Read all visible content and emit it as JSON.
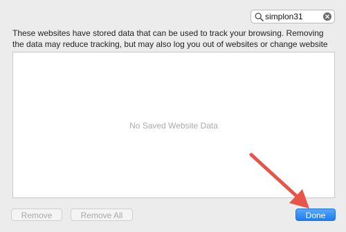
{
  "search": {
    "value": "simplon31"
  },
  "description": "These websites have stored data that can be used to track your browsing. Removing the data may reduce tracking, but may also log you out of websites or change website behavior.",
  "list": {
    "empty_text": "No Saved Website Data"
  },
  "buttons": {
    "remove": "Remove",
    "remove_all": "Remove All",
    "done": "Done"
  },
  "colors": {
    "accent": "#1c7df1",
    "annotation_arrow": "#e8534a"
  }
}
